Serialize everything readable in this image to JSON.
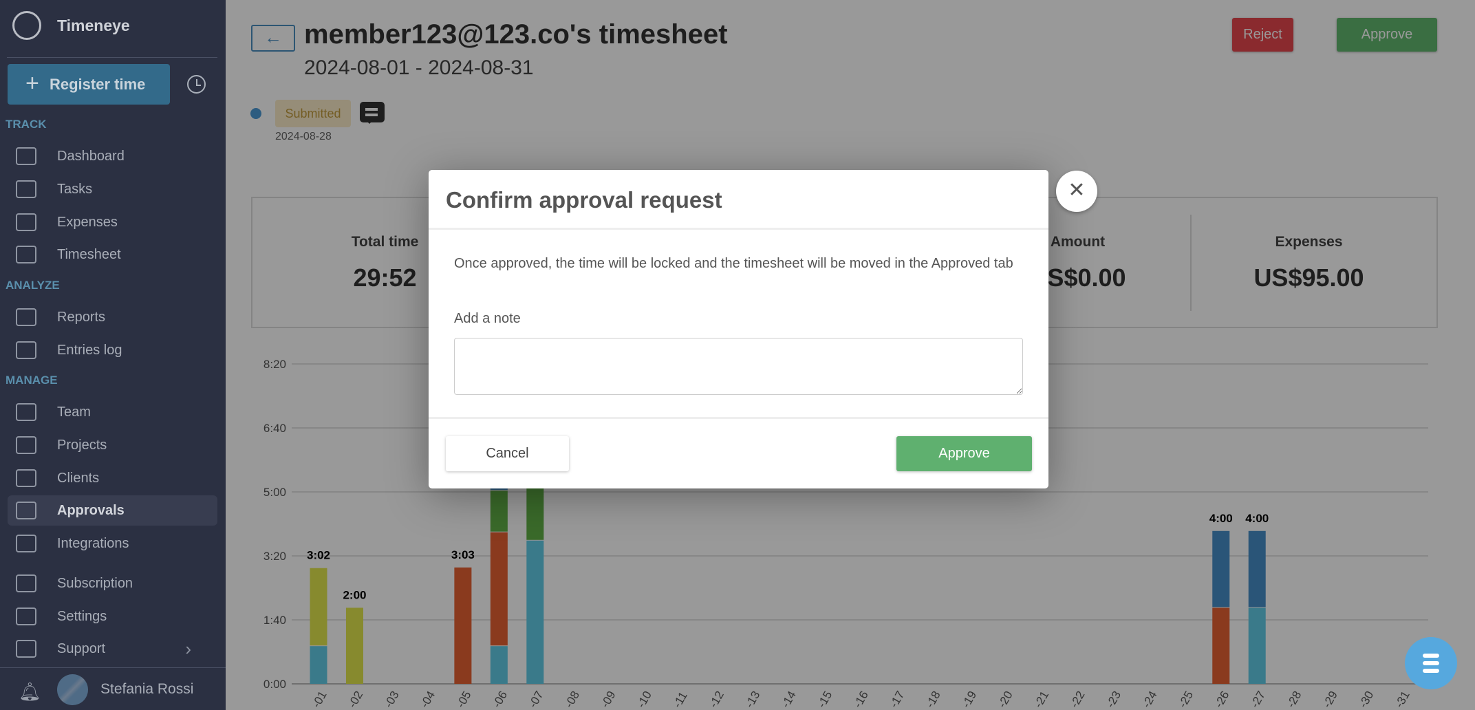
{
  "sidebar": {
    "brand": "Timeneye",
    "register_label": "Register time",
    "sections": {
      "track": "TRACK",
      "analyze": "ANALYZE",
      "manage": "MANAGE"
    },
    "items": [
      {
        "label": "Dashboard",
        "icon": "calendar-clock-icon"
      },
      {
        "label": "Tasks",
        "icon": "checklist-icon"
      },
      {
        "label": "Expenses",
        "icon": "wallet-icon"
      },
      {
        "label": "Timesheet",
        "icon": "calendar-edit-icon"
      },
      {
        "label": "Reports",
        "icon": "chart-line-icon"
      },
      {
        "label": "Entries log",
        "icon": "list-icon"
      },
      {
        "label": "Team",
        "icon": "team-icon"
      },
      {
        "label": "Projects",
        "icon": "folder-icon"
      },
      {
        "label": "Clients",
        "icon": "briefcase-icon"
      },
      {
        "label": "Approvals",
        "icon": "shield-check-icon"
      },
      {
        "label": "Integrations",
        "icon": "cubes-icon"
      },
      {
        "label": "Subscription",
        "icon": "credit-card-icon"
      },
      {
        "label": "Settings",
        "icon": "gear-icon"
      },
      {
        "label": "Support",
        "icon": "lifebuoy-icon"
      }
    ],
    "active": "Approvals",
    "user_name": "Stefania Rossi"
  },
  "header": {
    "title": "member123@123.co's timesheet",
    "date_range": "2024-08-01 - 2024-08-31",
    "status": "Submitted",
    "status_date": "2024-08-28",
    "reject_label": "Reject",
    "approve_label": "Approve",
    "back_icon": "←"
  },
  "summary": [
    {
      "label": "Total time",
      "value": "29:52"
    },
    {
      "label": "Amount",
      "value": "US$0.00"
    },
    {
      "label": "Expenses",
      "value": "US$95.00"
    }
  ],
  "colors": {
    "teal": "#61cbe6",
    "olive": "#e1e64d",
    "red": "#e66132",
    "green": "#61b146",
    "blue": "#468ec8",
    "reject": "#e6464d",
    "approve": "#61b86e",
    "dialog_approve": "#5fb06f"
  },
  "chart_data": {
    "type": "bar",
    "stacked": true,
    "unit": "minutes",
    "ylim": [
      0,
      500
    ],
    "yticks": [
      "0:00",
      "1:40",
      "3:20",
      "5:00",
      "6:40",
      "8:20"
    ],
    "categories": [
      "-01",
      "-02",
      "-03",
      "-04",
      "-05",
      "-06",
      "-07",
      "-08",
      "-09",
      "-10",
      "-11",
      "-12",
      "-13",
      "-14",
      "-15",
      "-16",
      "-17",
      "-18",
      "-19",
      "-20",
      "-21",
      "-22",
      "-23",
      "-24",
      "-25",
      "-26",
      "-27",
      "-28",
      "-29",
      "-30",
      "-31"
    ],
    "bars": [
      {
        "day": 1,
        "label": "3:02",
        "segments": [
          {
            "color": "teal",
            "value": 60
          },
          {
            "color": "olive",
            "value": 122
          }
        ]
      },
      {
        "day": 2,
        "label": "2:00",
        "segments": [
          {
            "color": "olive",
            "value": 120
          }
        ]
      },
      {
        "day": 5,
        "label": "3:03",
        "segments": [
          {
            "color": "red",
            "value": 183
          }
        ]
      },
      {
        "day": 6,
        "label": "",
        "segments": [
          {
            "color": "teal",
            "value": 60
          },
          {
            "color": "red",
            "value": 178
          },
          {
            "color": "green",
            "value": 65
          },
          {
            "color": "blue",
            "value": 20
          }
        ]
      },
      {
        "day": 7,
        "label": "",
        "segments": [
          {
            "color": "teal",
            "value": 225
          },
          {
            "color": "green",
            "value": 90
          }
        ]
      },
      {
        "day": 26,
        "label": "4:00",
        "segments": [
          {
            "color": "red",
            "value": 120
          },
          {
            "color": "blue",
            "value": 120
          }
        ]
      },
      {
        "day": 27,
        "label": "4:00",
        "segments": [
          {
            "color": "teal",
            "value": 120
          },
          {
            "color": "blue",
            "value": 120
          }
        ]
      }
    ]
  },
  "dialog": {
    "title": "Confirm approval request",
    "message": "Once approved, the time will be locked and the timesheet will be moved in the Approved tab",
    "note_label": "Add a note",
    "note_value": "",
    "note_placeholder": "",
    "cancel_label": "Cancel",
    "approve_label": "Approve",
    "close_icon": "✕"
  }
}
